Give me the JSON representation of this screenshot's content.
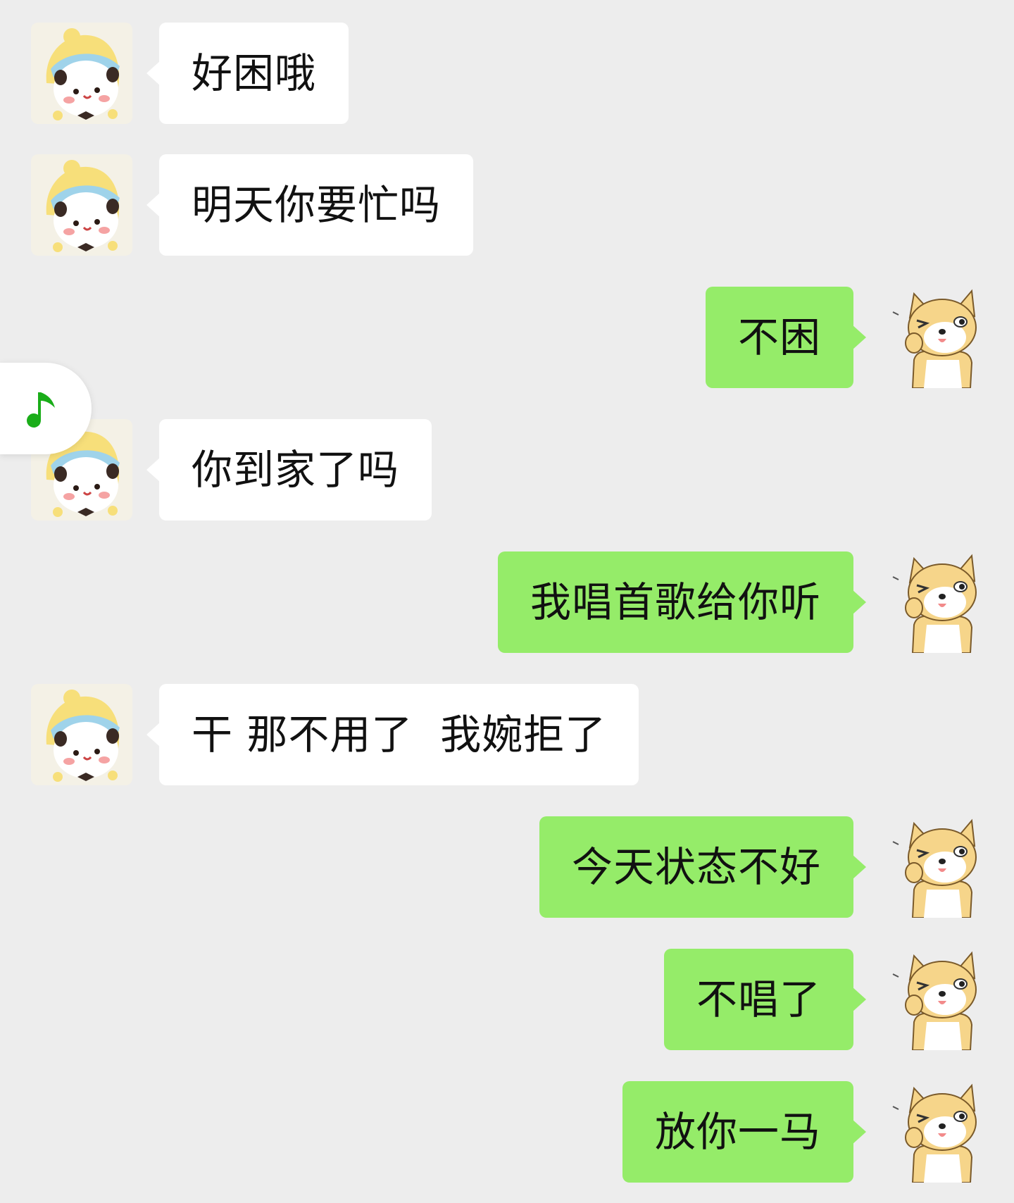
{
  "colors": {
    "background": "#ededed",
    "incoming_bubble": "#ffffff",
    "outgoing_bubble": "#95ec69",
    "music_note": "#1aad19"
  },
  "floating_widget": {
    "icon": "music-note-icon"
  },
  "messages": [
    {
      "side": "in",
      "avatar": "panda-hat-avatar",
      "text": "好困哦"
    },
    {
      "side": "in",
      "avatar": "panda-hat-avatar",
      "text": "明天你要忙吗"
    },
    {
      "side": "out",
      "avatar": "shiba-wink-avatar",
      "text": "不困"
    },
    {
      "side": "in",
      "avatar": "panda-hat-avatar",
      "text": "你到家了吗"
    },
    {
      "side": "out",
      "avatar": "shiba-wink-avatar",
      "text": "我唱首歌给你听"
    },
    {
      "side": "in",
      "avatar": "panda-hat-avatar",
      "text": "干 那不用了  我婉拒了"
    },
    {
      "side": "out",
      "avatar": "shiba-wink-avatar",
      "text": "今天状态不好"
    },
    {
      "side": "out",
      "avatar": "shiba-wink-avatar",
      "text": "不唱了"
    },
    {
      "side": "out",
      "avatar": "shiba-wink-avatar",
      "text": "放你一马"
    }
  ]
}
